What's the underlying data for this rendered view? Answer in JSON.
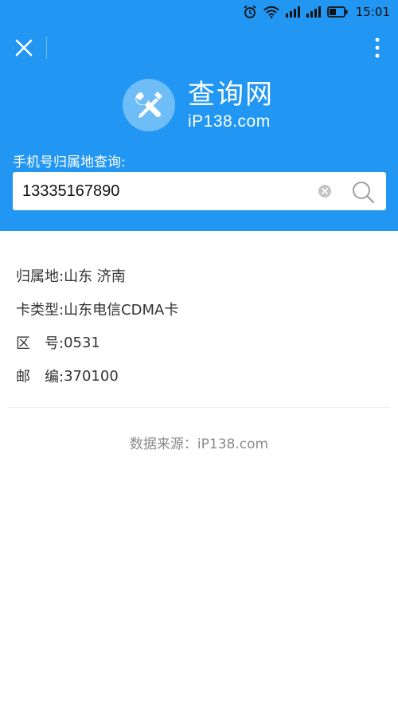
{
  "status_bar": {
    "time": "15:01",
    "icons": [
      "alarm-icon",
      "wifi-icon",
      "signal-icon",
      "signal-icon",
      "battery-icon"
    ]
  },
  "toolbar": {
    "close_icon": "close-icon",
    "menu_icon": "more-vertical-icon"
  },
  "logo": {
    "title": "查询网",
    "subtitle": "iP138.com",
    "icon": "tools-icon"
  },
  "search": {
    "label": "手机号归属地查询:",
    "value": "13335167890",
    "clear_icon": "clear-icon",
    "search_icon": "search-icon"
  },
  "results": [
    {
      "label": "归属地:",
      "value": "山东 济南"
    },
    {
      "label": "卡类型:",
      "value": "山东电信CDMA卡"
    },
    {
      "label": "区　号:",
      "value": "0531"
    },
    {
      "label": "邮　编:",
      "value": "370100"
    }
  ],
  "footer": {
    "source": "数据来源：iP138.com"
  },
  "colors": {
    "header_bg": "#2196f3",
    "logo_badge": "#6fbdf7",
    "text_primary": "#333333",
    "text_muted": "#8a8a8a"
  }
}
